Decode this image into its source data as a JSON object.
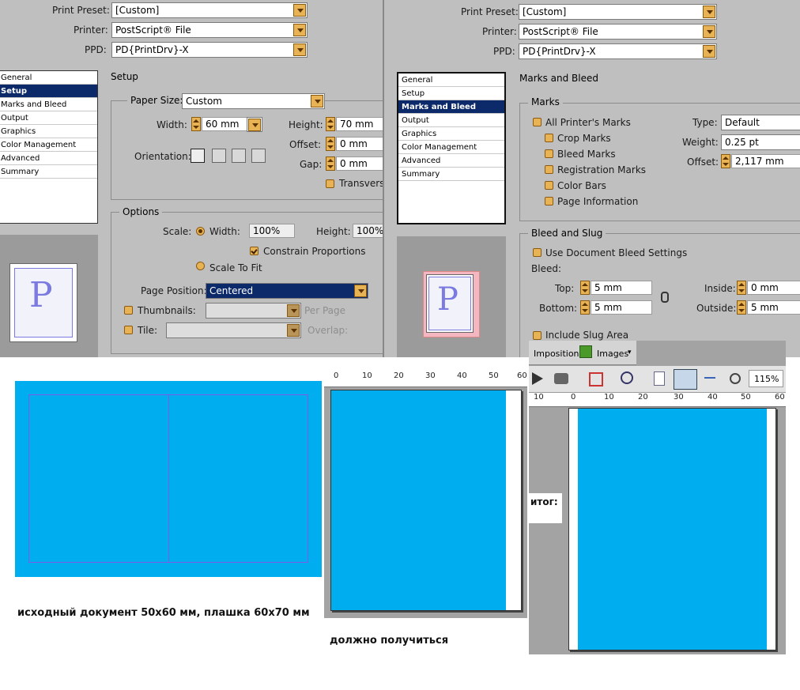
{
  "left_dialog": {
    "print_preset_label": "Print Preset:",
    "print_preset_value": "[Custom]",
    "printer_label": "Printer:",
    "printer_value": "PostScript® File",
    "ppd_label": "PPD:",
    "ppd_value": "PD{PrintDrv}-X",
    "nav": [
      "General",
      "Setup",
      "Marks and Bleed",
      "Output",
      "Graphics",
      "Color Management",
      "Advanced",
      "Summary"
    ],
    "section_title": "Setup",
    "paper_size_label": "Paper Size:",
    "paper_size_value": "Custom",
    "width_label": "Width:",
    "width_value": "60 mm",
    "height_label": "Height:",
    "height_value": "70 mm",
    "offset_label": "Offset:",
    "offset_value": "0 mm",
    "gap_label": "Gap:",
    "gap_value": "0 mm",
    "orientation_label": "Orientation:",
    "transverse_label": "Transverse",
    "options_title": "Options",
    "scale_label": "Scale:",
    "scale_width_label": "Width:",
    "scale_width_value": "100%",
    "scale_height_label": "Height:",
    "scale_height_value": "100%",
    "constrain_label": "Constrain Proportions",
    "scale_to_fit_label": "Scale To Fit",
    "page_position_label": "Page Position:",
    "page_position_value": "Centered",
    "thumbnails_label": "Thumbnails:",
    "per_page_label": "Per Page",
    "tile_label": "Tile:",
    "overlap_label": "Overlap:",
    "preview_letter": "P"
  },
  "right_dialog": {
    "print_preset_label": "Print Preset:",
    "print_preset_value": "[Custom]",
    "printer_label": "Printer:",
    "printer_value": "PostScript® File",
    "ppd_label": "PPD:",
    "ppd_value": "PD{PrintDrv}-X",
    "nav": [
      "General",
      "Setup",
      "Marks and Bleed",
      "Output",
      "Graphics",
      "Color Management",
      "Advanced",
      "Summary"
    ],
    "section_title": "Marks and Bleed",
    "marks_title": "Marks",
    "all_printers_marks": "All Printer's Marks",
    "crop_marks": "Crop Marks",
    "bleed_marks": "Bleed Marks",
    "registration_marks": "Registration Marks",
    "color_bars": "Color Bars",
    "page_information": "Page Information",
    "type_label": "Type:",
    "type_value": "Default",
    "weight_label": "Weight:",
    "weight_value": "0.25 pt",
    "offset_label": "Offset:",
    "offset_value": "2,117 mm",
    "bleed_slug_title": "Bleed and Slug",
    "use_doc_bleed": "Use Document Bleed Settings",
    "bleed_label": "Bleed:",
    "top_label": "Top:",
    "top_value": "5 mm",
    "bottom_label": "Bottom:",
    "bottom_value": "5 mm",
    "inside_label": "Inside:",
    "inside_value": "0 mm",
    "outside_label": "Outside:",
    "outside_value": "5 mm",
    "include_slug": "Include Slug Area",
    "preview_letter": "P"
  },
  "mid_ruler": {
    "labels": [
      "0",
      "10",
      "20",
      "30",
      "40",
      "50",
      "60"
    ]
  },
  "toolbar": {
    "imposition_tab": "Imposition",
    "images_tab": "Images",
    "zoom_value": "115%",
    "ruler_labels": [
      "10",
      "0",
      "10",
      "20",
      "30",
      "40",
      "50",
      "60"
    ]
  },
  "captions": {
    "source_doc": "исходный документ 50х60 мм, плашка 60х70 мм",
    "should_be": "должно получиться",
    "result": "итог:"
  },
  "colors": {
    "cyan": "#00adef",
    "dialog_bg": "#bfbfbf",
    "nav_selected": "#0c2a6a",
    "accent_orange": "#e7b355"
  }
}
